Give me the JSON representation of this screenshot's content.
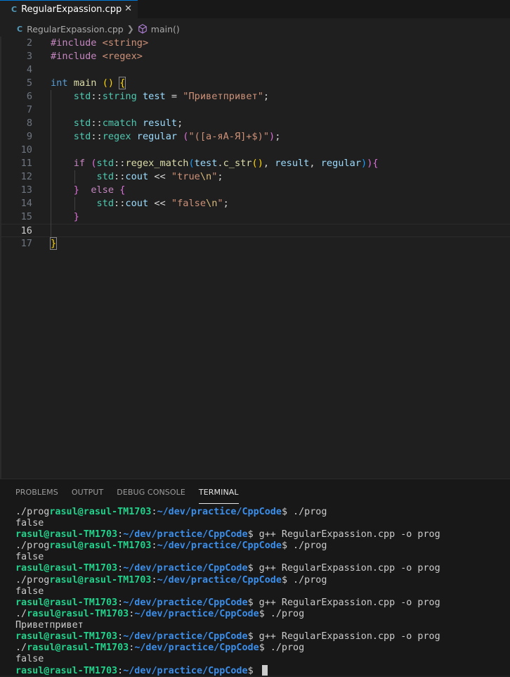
{
  "tab": {
    "filename": "RegularExpassion.cpp",
    "close_glyph": "✕",
    "icon": "C-icon"
  },
  "breadcrumb": {
    "file": "RegularExpassion.cpp",
    "symbol": "main()"
  },
  "editor": {
    "current_line": 16,
    "lines": [
      {
        "n": "2",
        "tokens": [
          [
            "pp",
            "#include "
          ],
          [
            "inc",
            "<string>"
          ]
        ]
      },
      {
        "n": "3",
        "tokens": [
          [
            "pp",
            "#include "
          ],
          [
            "inc",
            "<regex>"
          ]
        ]
      },
      {
        "n": "4",
        "tokens": []
      },
      {
        "n": "5",
        "tokens": [
          [
            "kw",
            "int"
          ],
          [
            "pl",
            " "
          ],
          [
            "fn",
            "main"
          ],
          [
            "pl",
            " "
          ],
          [
            "br1",
            "()"
          ],
          [
            "pl",
            " "
          ],
          [
            "br1 matched",
            "{"
          ]
        ]
      },
      {
        "n": "6",
        "tokens": [
          [
            "pl",
            "    "
          ],
          [
            "ns",
            "std"
          ],
          [
            "pl",
            "::"
          ],
          [
            "type",
            "string"
          ],
          [
            "pl",
            " "
          ],
          [
            "var",
            "test"
          ],
          [
            "pl",
            " = "
          ],
          [
            "str",
            "\"Приветпривет\""
          ],
          [
            "pl",
            ";"
          ]
        ]
      },
      {
        "n": "7",
        "tokens": []
      },
      {
        "n": "8",
        "tokens": [
          [
            "pl",
            "    "
          ],
          [
            "ns",
            "std"
          ],
          [
            "pl",
            "::"
          ],
          [
            "type",
            "cmatch"
          ],
          [
            "pl",
            " "
          ],
          [
            "var",
            "result"
          ],
          [
            "pl",
            ";"
          ]
        ]
      },
      {
        "n": "9",
        "tokens": [
          [
            "pl",
            "    "
          ],
          [
            "ns",
            "std"
          ],
          [
            "pl",
            "::"
          ],
          [
            "type",
            "regex"
          ],
          [
            "pl",
            " "
          ],
          [
            "var",
            "regular"
          ],
          [
            "pl",
            " "
          ],
          [
            "br2",
            "("
          ],
          [
            "str",
            "\"([а-яА-Я]+$)\""
          ],
          [
            "br2",
            ")"
          ],
          [
            "pl",
            ";"
          ]
        ]
      },
      {
        "n": "10",
        "tokens": []
      },
      {
        "n": "11",
        "tokens": [
          [
            "pl",
            "    "
          ],
          [
            "pp",
            "if"
          ],
          [
            "pl",
            " "
          ],
          [
            "br2",
            "("
          ],
          [
            "ns",
            "std"
          ],
          [
            "pl",
            "::"
          ],
          [
            "fn",
            "regex_match"
          ],
          [
            "br3",
            "("
          ],
          [
            "var",
            "test"
          ],
          [
            "pl",
            "."
          ],
          [
            "fn",
            "c_str"
          ],
          [
            "br1",
            "()"
          ],
          [
            "pl",
            ", "
          ],
          [
            "var",
            "result"
          ],
          [
            "pl",
            ", "
          ],
          [
            "var",
            "regular"
          ],
          [
            "br3",
            ")"
          ],
          [
            "br2",
            ")"
          ],
          [
            "br2",
            "{"
          ]
        ]
      },
      {
        "n": "12",
        "tokens": [
          [
            "pl",
            "        "
          ],
          [
            "ns",
            "std"
          ],
          [
            "pl",
            "::"
          ],
          [
            "var",
            "cout"
          ],
          [
            "pl",
            " << "
          ],
          [
            "str",
            "\"true"
          ],
          [
            "esc",
            "\\n"
          ],
          [
            "str",
            "\""
          ],
          [
            "pl",
            ";"
          ]
        ]
      },
      {
        "n": "13",
        "tokens": [
          [
            "pl",
            "    "
          ],
          [
            "br2",
            "}"
          ],
          [
            "pl",
            "  "
          ],
          [
            "pp",
            "else"
          ],
          [
            "pl",
            " "
          ],
          [
            "br2",
            "{"
          ]
        ]
      },
      {
        "n": "14",
        "tokens": [
          [
            "pl",
            "        "
          ],
          [
            "ns",
            "std"
          ],
          [
            "pl",
            "::"
          ],
          [
            "var",
            "cout"
          ],
          [
            "pl",
            " << "
          ],
          [
            "str",
            "\"false"
          ],
          [
            "esc",
            "\\n"
          ],
          [
            "str",
            "\""
          ],
          [
            "pl",
            ";"
          ]
        ]
      },
      {
        "n": "15",
        "tokens": [
          [
            "pl",
            "    "
          ],
          [
            "br2",
            "}"
          ]
        ]
      },
      {
        "n": "16",
        "tokens": []
      },
      {
        "n": "17",
        "tokens": [
          [
            "br1 matched",
            "}"
          ]
        ]
      }
    ]
  },
  "panel": {
    "tabs": [
      {
        "label": "PROBLEMS",
        "active": false
      },
      {
        "label": "OUTPUT",
        "active": false
      },
      {
        "label": "DEBUG CONSOLE",
        "active": false
      },
      {
        "label": "TERMINAL",
        "active": true
      }
    ]
  },
  "terminal": {
    "user_host": "rasul@rasul-TM1703",
    "path": "~/dev/practice/CppCode",
    "lines": [
      {
        "pre": "./prog",
        "prompt": true,
        "cmd": " ./prog"
      },
      {
        "text": "false"
      },
      {
        "pre": "",
        "prompt": true,
        "cmd": " g++ RegularExpassion.cpp -o prog"
      },
      {
        "pre": "./prog",
        "prompt": true,
        "cmd": " ./prog"
      },
      {
        "text": "false"
      },
      {
        "pre": "",
        "prompt": true,
        "cmd": " g++ RegularExpassion.cpp -o prog"
      },
      {
        "pre": "./prog",
        "prompt": true,
        "cmd": " ./prog"
      },
      {
        "text": "false"
      },
      {
        "pre": "",
        "prompt": true,
        "cmd": " g++ RegularExpassion.cpp -o prog"
      },
      {
        "pre": "./",
        "prompt": true,
        "cmd": " ./prog"
      },
      {
        "text": "Приветпривет"
      },
      {
        "pre": "",
        "prompt": true,
        "cmd": " g++ RegularExpassion.cpp -o prog"
      },
      {
        "pre": "./",
        "prompt": true,
        "cmd": " ./prog"
      },
      {
        "text": "false"
      },
      {
        "pre": "",
        "prompt": true,
        "cmd": " ",
        "cursor": true
      }
    ]
  }
}
